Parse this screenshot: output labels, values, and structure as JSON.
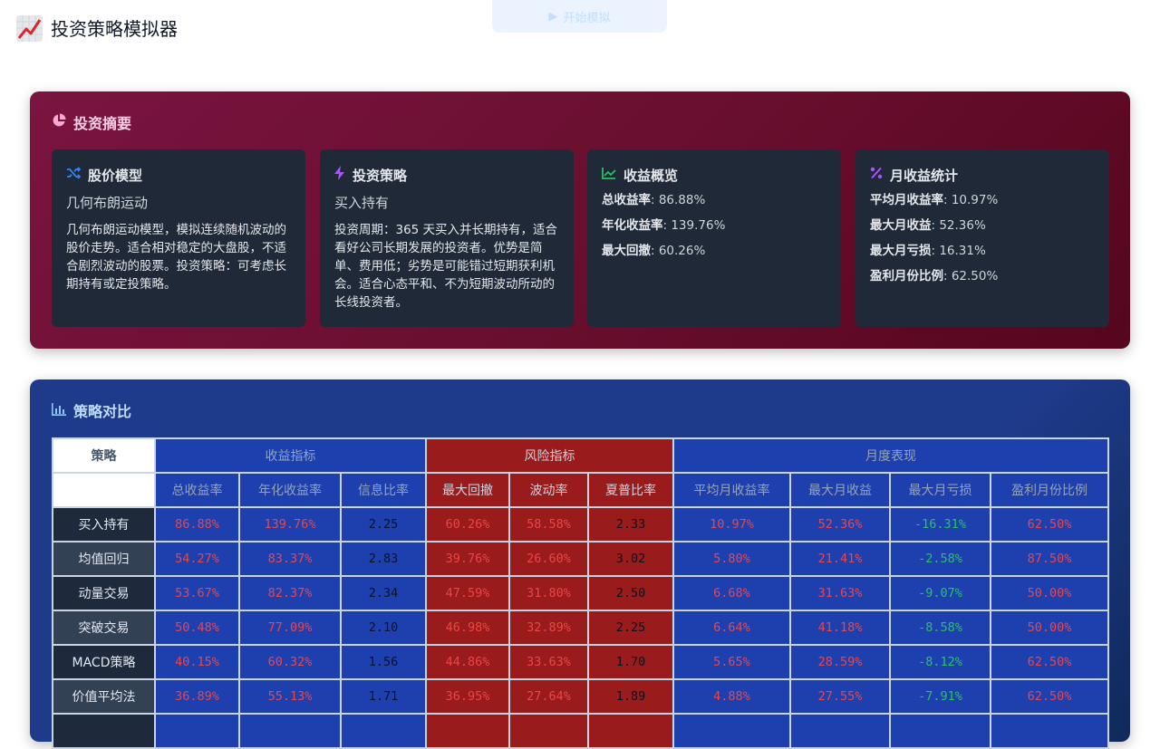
{
  "header": {
    "title": "投资策略模拟器",
    "faded_button": "开始模拟"
  },
  "summary": {
    "title": "投资摘要",
    "model": {
      "head": "股价模型",
      "sub": "几何布朗运动",
      "desc": "几何布朗运动模型，模拟连续随机波动的股价走势。适合相对稳定的大盘股，不适合剧烈波动的股票。投资策略：可考虑长期持有或定投策略。"
    },
    "strategy": {
      "head": "投资策略",
      "sub": "买入持有",
      "desc": "投资周期：365 天买入并长期持有，适合看好公司长期发展的投资者。优势是简单、费用低；劣势是可能错过短期获利机会。适合心态平和、不为短期波动所动的长线投资者。"
    },
    "returns": {
      "head": "收益概览",
      "items": [
        {
          "label": "总收益率",
          "value": ": 86.88%"
        },
        {
          "label": "年化收益率",
          "value": ": 139.76%"
        },
        {
          "label": "最大回撤",
          "value": ": 60.26%"
        }
      ]
    },
    "monthly": {
      "head": "月收益统计",
      "items": [
        {
          "label": "平均月收益率",
          "value": ": 10.97%"
        },
        {
          "label": "最大月收益",
          "value": ": 52.36%"
        },
        {
          "label": "最大月亏损",
          "value": ": 16.31%"
        },
        {
          "label": "盈利月份比例",
          "value": ": 62.50%"
        }
      ]
    }
  },
  "compare": {
    "title": "策略对比",
    "group_headers": {
      "strategy": "策略",
      "returns": "收益指标",
      "risk": "风险指标",
      "monthly": "月度表现"
    },
    "columns": [
      "总收益率",
      "年化收益率",
      "信息比率",
      "最大回撤",
      "波动率",
      "夏普比率",
      "平均月收益率",
      "最大月收益",
      "最大月亏损",
      "盈利月份比例"
    ],
    "rows": [
      {
        "name": "买入持有",
        "values": [
          "86.88%",
          "139.76%",
          "2.25",
          "60.26%",
          "58.58%",
          "2.33",
          "10.97%",
          "52.36%",
          "-16.31%",
          "62.50%"
        ]
      },
      {
        "name": "均值回归",
        "values": [
          "54.27%",
          "83.37%",
          "2.83",
          "39.76%",
          "26.60%",
          "3.02",
          "5.80%",
          "21.41%",
          "-2.58%",
          "87.50%"
        ]
      },
      {
        "name": "动量交易",
        "values": [
          "53.67%",
          "82.37%",
          "2.34",
          "47.59%",
          "31.80%",
          "2.50",
          "6.68%",
          "31.63%",
          "-9.07%",
          "50.00%"
        ]
      },
      {
        "name": "突破交易",
        "values": [
          "50.48%",
          "77.09%",
          "2.10",
          "46.98%",
          "32.89%",
          "2.25",
          "6.64%",
          "41.18%",
          "-8.58%",
          "50.00%"
        ]
      },
      {
        "name": "MACD策略",
        "values": [
          "40.15%",
          "60.32%",
          "1.56",
          "44.86%",
          "33.63%",
          "1.70",
          "5.65%",
          "28.59%",
          "-8.12%",
          "62.50%"
        ]
      },
      {
        "name": "价值平均法",
        "values": [
          "36.89%",
          "55.13%",
          "1.71",
          "36.95%",
          "27.64%",
          "1.89",
          "4.88%",
          "27.55%",
          "-7.91%",
          "62.50%"
        ]
      },
      {
        "name": "",
        "values": [
          "",
          "",
          "",
          "",
          "",
          "",
          "",
          "",
          "",
          ""
        ]
      }
    ]
  }
}
